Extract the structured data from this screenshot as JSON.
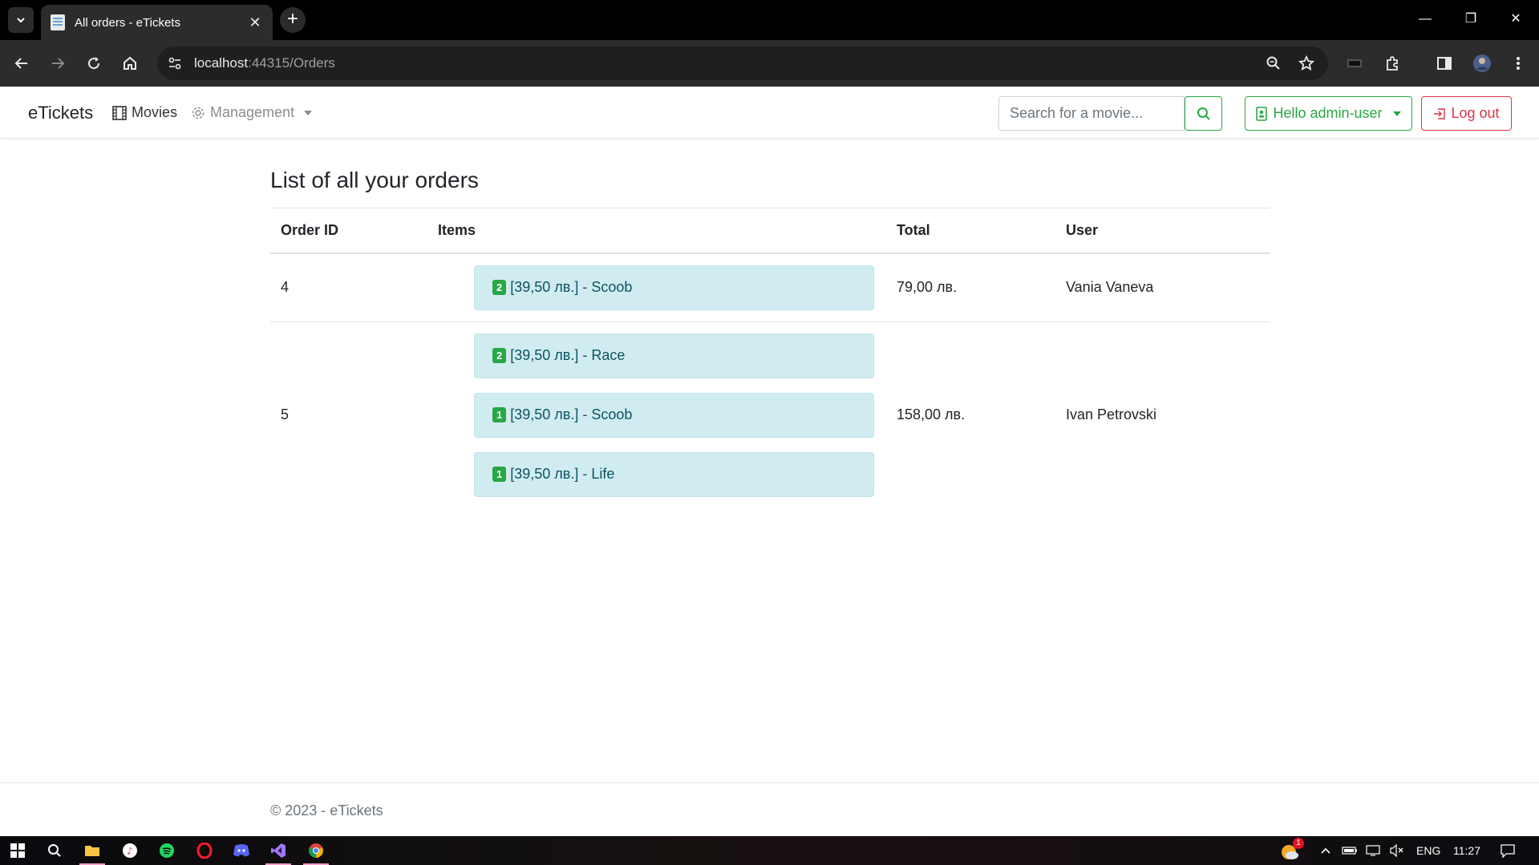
{
  "browser": {
    "tab_title": "All orders - eTickets",
    "url_host": "localhost",
    "url_path": ":44315/Orders"
  },
  "navbar": {
    "brand": "eTickets",
    "movies_label": "Movies",
    "management_label": "Management",
    "search_placeholder": "Search for a movie...",
    "user_label": "Hello admin-user",
    "logout_label": "Log out"
  },
  "page": {
    "title": "List of all your orders"
  },
  "table": {
    "headers": {
      "order_id": "Order ID",
      "items": "Items",
      "total": "Total",
      "user": "User"
    },
    "rows": [
      {
        "order_id": "4",
        "items": [
          {
            "qty": "2",
            "text": "[39,50 лв.] - Scoob"
          }
        ],
        "total": "79,00 лв.",
        "user": "Vania Vaneva"
      },
      {
        "order_id": "5",
        "items": [
          {
            "qty": "2",
            "text": "[39,50 лв.] - Race"
          },
          {
            "qty": "1",
            "text": "[39,50 лв.] - Scoob"
          },
          {
            "qty": "1",
            "text": "[39,50 лв.] - Life"
          }
        ],
        "total": "158,00 лв.",
        "user": "Ivan Petrovski"
      }
    ]
  },
  "footer": {
    "text": "© 2023 - eTickets"
  },
  "taskbar": {
    "language": "ENG",
    "time": "11:27",
    "notification_count": "1"
  },
  "colors": {
    "success": "#28a745",
    "danger": "#dc3545",
    "info_bg": "#d1ecf1",
    "info_text": "#0c5460"
  }
}
